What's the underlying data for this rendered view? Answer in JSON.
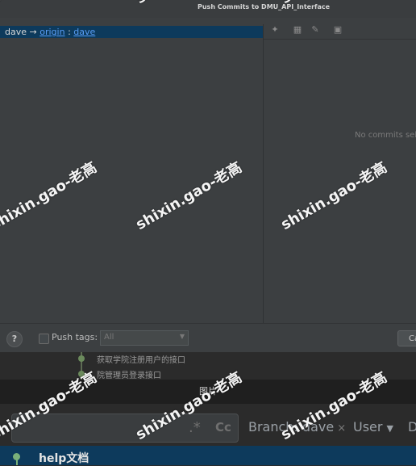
{
  "dialog": {
    "title": "Push Commits to DMU_API_Interface",
    "branch": {
      "local": "dave",
      "arrow": "→",
      "remote": "origin",
      "separator": ":",
      "remote_branch": "dave"
    },
    "no_commits_text": "No commits sele",
    "help_label": "?",
    "push_tags_label": "Push tags:",
    "push_tags_value": "All",
    "cancel_label": "Ca"
  },
  "background": {
    "commits": [
      "获取学院注册用户的接口",
      "院管理员登录接口"
    ],
    "caption": "图片",
    "filters": {
      "branch_label": "Branch: dave",
      "user_label": "User",
      "date_label": "D"
    },
    "tree_item": "help文档"
  },
  "watermark": "shixin.gao-老高"
}
